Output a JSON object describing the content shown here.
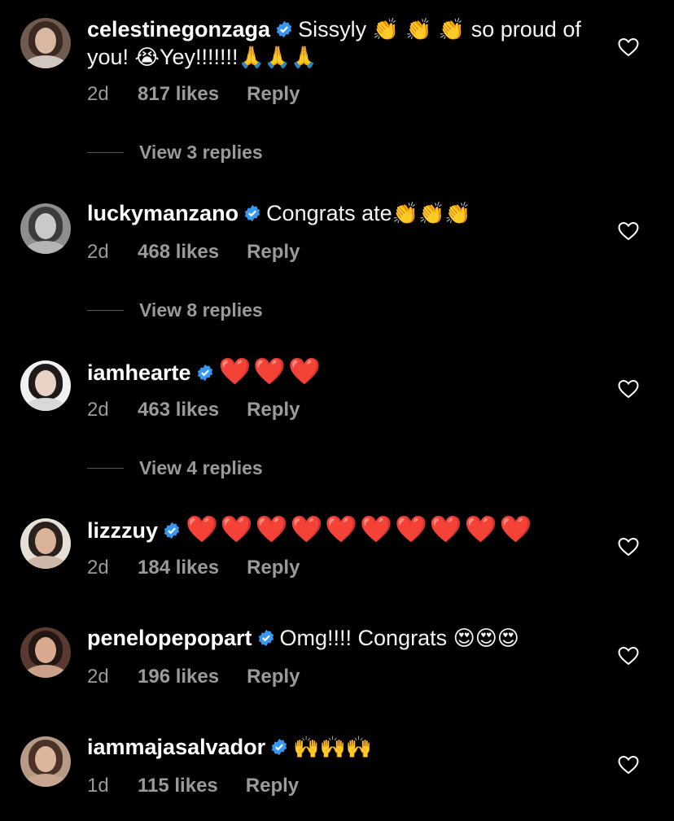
{
  "comments": [
    {
      "username": "celestinegonzaga",
      "text_before": "Sissyly ",
      "emoji_1": "👏 👏 👏",
      "text_middle": " so proud of you! ",
      "emoji_2": "😭",
      "text_after": "Yey!!!!!!!",
      "emoji_3": "🙏🙏🙏",
      "age": "2d",
      "likes": "817 likes",
      "reply": "Reply",
      "view_replies": "View 3 replies"
    },
    {
      "username": "luckymanzano",
      "text_before": "Congrats ate",
      "emoji_1": "👏👏👏",
      "age": "2d",
      "likes": "468 likes",
      "reply": "Reply",
      "view_replies": "View 8 replies"
    },
    {
      "username": "iamhearte",
      "emoji_1": "❤️❤️❤️",
      "age": "2d",
      "likes": "463 likes",
      "reply": "Reply",
      "view_replies": "View 4 replies"
    },
    {
      "username": "lizzzuy",
      "emoji_1": "❤️❤️❤️❤️❤️❤️❤️❤️❤️❤️",
      "age": "2d",
      "likes": "184 likes",
      "reply": "Reply"
    },
    {
      "username": "penelopepopart",
      "text_before": "Omg!!!! Congrats ",
      "emoji_1": "😍😍😍",
      "age": "2d",
      "likes": "196 likes",
      "reply": "Reply"
    },
    {
      "username": "iammajasalvador",
      "emoji_1": "🙌🙌🙌",
      "age": "1d",
      "likes": "115 likes",
      "reply": "Reply"
    }
  ],
  "colors": {
    "background": "#000000",
    "text": "#ffffff",
    "secondary_text": "#9a9a9a",
    "verified_badge": "#3897f0",
    "heart_emoji": "#ef1f2c"
  },
  "icons": {
    "verified": "verified-badge-icon",
    "like": "heart-outline-icon"
  }
}
